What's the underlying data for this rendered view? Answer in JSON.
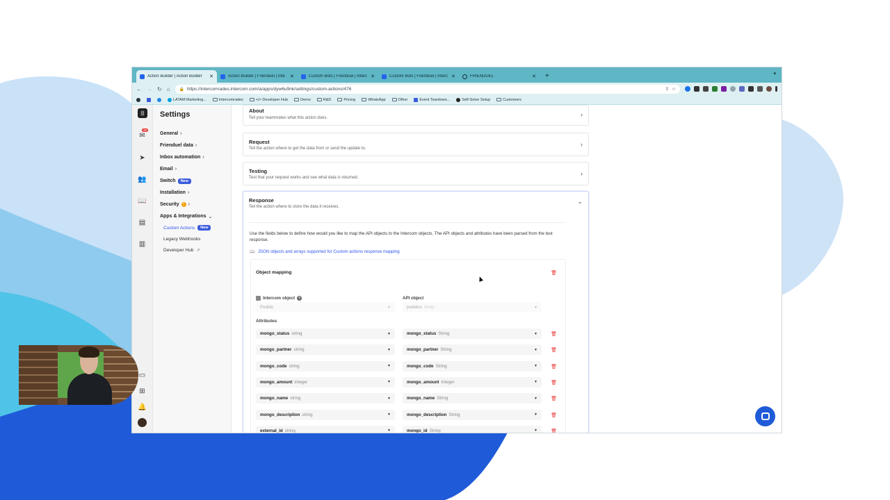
{
  "browser": {
    "tabs": [
      {
        "title": "Action Builder | Action Builder",
        "active": true
      },
      {
        "title": "Action Builder | Frienduel | Inte",
        "active": false
      },
      {
        "title": "Custom Bots | Frienduel | Interc",
        "active": false
      },
      {
        "title": "Custom Bots | Frienduel | Interc",
        "active": false
      },
      {
        "title": "FRIENDUEL",
        "active": false
      }
    ],
    "url": "https://intercomrades.intercom.com/a/apps/dyw6u9nk/settings/custom-actions/476",
    "bookmarks": [
      "LATAM Marketing...",
      "Intercomrades",
      "</> Developer Hub",
      "Demo",
      "R&D",
      "Pricing",
      "WhatsApp",
      "Other",
      "Event Teardown...",
      "Self-Solve Setup",
      "Customers"
    ]
  },
  "settings": {
    "title": "Settings",
    "nav": [
      {
        "label": "General"
      },
      {
        "label": "Frienduel data"
      },
      {
        "label": "Inbox automation"
      },
      {
        "label": "Email"
      },
      {
        "label": "Switch",
        "badge": "New"
      },
      {
        "label": "Installation"
      },
      {
        "label": "Security"
      },
      {
        "label": "Apps & Integrations"
      }
    ],
    "subnav": [
      {
        "label": "Custom Actions",
        "badge": "New"
      },
      {
        "label": "Legacy Webhooks"
      },
      {
        "label": "Developer Hub"
      }
    ]
  },
  "sections": [
    {
      "title": "About",
      "desc": "Tell your teammates what this action does."
    },
    {
      "title": "Request",
      "desc": "Tell the action where to get the data from or send the update to."
    },
    {
      "title": "Testing",
      "desc": "Test that your request works and see what data is returned."
    },
    {
      "title": "Response",
      "desc": "Tell the action where to store the data it receives."
    }
  ],
  "response": {
    "intro": "Use the fields below to define how would you like to map the API objects to the Intercom objects. The API objects and attributes have been parsed from the test response.",
    "link": "JSON objects and arrays supported for Custom actions response mapping",
    "mapping": {
      "title": "Object mapping",
      "intercom_object_label": "Intercom object",
      "api_object_label": "API object",
      "intercom_object_value": "Pedido",
      "api_object_value": "pedidos",
      "api_object_type": "Array",
      "attributes_label": "Attributes",
      "attributes": [
        {
          "left": "mongo_status",
          "left_type": "string",
          "right": "mongo_status",
          "right_type": "String"
        },
        {
          "left": "mongo_partner",
          "left_type": "string",
          "right": "mongo_partner",
          "right_type": "String"
        },
        {
          "left": "mongo_code",
          "left_type": "string",
          "right": "mongo_code",
          "right_type": "String"
        },
        {
          "left": "mongo_amount",
          "left_type": "integer",
          "right": "mongo_amount",
          "right_type": "Integer"
        },
        {
          "left": "mongo_name",
          "left_type": "string",
          "right": "mongo_name",
          "right_type": "String"
        },
        {
          "left": "mongo_description",
          "left_type": "string",
          "right": "mongo_description",
          "right_type": "String"
        },
        {
          "left": "external_id",
          "left_type": "string",
          "right": "mongo_id",
          "right_type": "String"
        }
      ]
    }
  },
  "colors": {
    "tabbar": "#5fb6c5",
    "accent": "#2f54eb",
    "danger": "#e53935",
    "messenger": "#1f5bd8"
  }
}
